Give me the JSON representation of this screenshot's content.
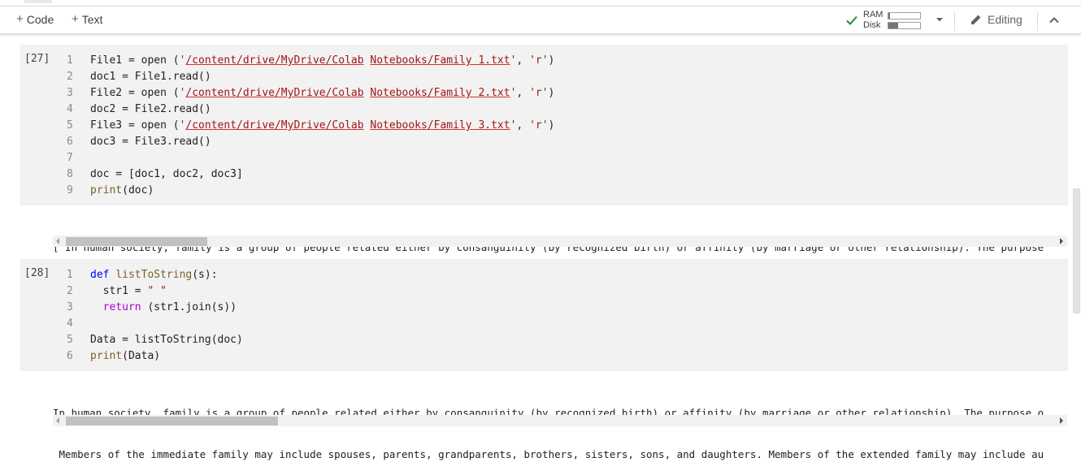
{
  "toolbar": {
    "add_code": "Code",
    "add_text": "Text",
    "resources": {
      "ram_label": "RAM",
      "disk_label": "Disk",
      "ram_fraction": 0.05,
      "disk_fraction": 0.3,
      "status": "connected"
    },
    "editing_label": "Editing",
    "icons": {
      "check": "check-icon",
      "caret": "caret-down-icon",
      "pencil": "pencil-icon",
      "collapse": "chevron-up-icon"
    }
  },
  "cells": [
    {
      "exec_count": "[27]",
      "line_numbers": [
        "1",
        "2",
        "3",
        "4",
        "5",
        "6",
        "7",
        "8",
        "9"
      ],
      "code": [
        "File1 = open ('/content/drive/MyDrive/Colab Notebooks/Family 1.txt', 'r')",
        "doc1 = File1.read()",
        "File2 = open ('/content/drive/MyDrive/Colab Notebooks/Family 2.txt', 'r')",
        "doc2 = File2.read()",
        "File3 = open ('/content/drive/MyDrive/Colab Notebooks/Family 3.txt', 'r')",
        "doc3 = File3.read()",
        "",
        "doc = [doc1, doc2, doc3]",
        "print(doc)"
      ],
      "output": [
        "['In human society, family is a group of people related either by consanguinity (by recognized birth) or affinity (by marriage or other relationship). The purpose"
      ],
      "output_scroll_fraction": 0.15
    },
    {
      "exec_count": "[28]",
      "line_numbers": [
        "1",
        "2",
        "3",
        "4",
        "5",
        "6"
      ],
      "code": [
        "def listToString(s):",
        "  str1 = \" \"",
        "  return (str1.join(s))",
        "",
        "Data = listToString(doc)",
        "print(Data)"
      ],
      "output": [
        "In human society, family is a group of people related either by consanguinity (by recognized birth) or affinity (by marriage or other relationship). The purpose o",
        " Members of the immediate family may include spouses, parents, grandparents, brothers, sisters, sons, and daughters. Members of the extended family may include au"
      ],
      "output_scroll_fraction": 0.22
    }
  ]
}
